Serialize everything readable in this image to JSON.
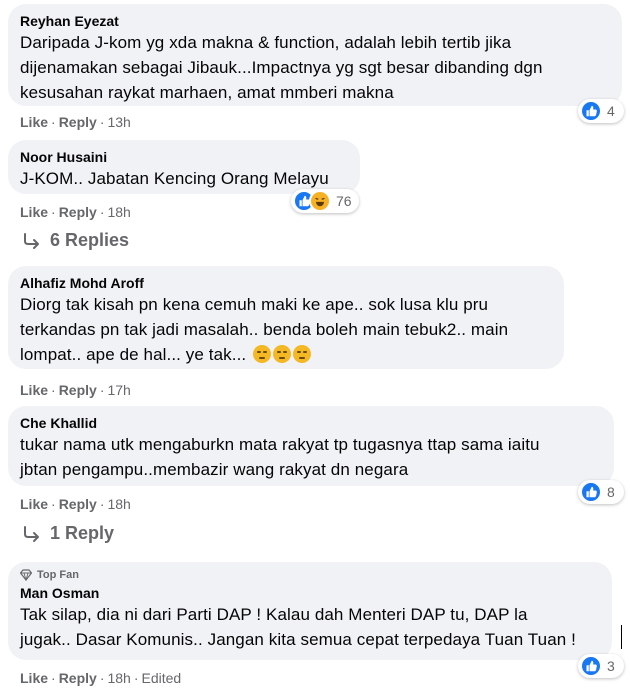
{
  "comments": [
    {
      "author": "Reyhan Eyezat",
      "text": "Daripada J-kom yg xda makna & function, adalah lebih tertib jika\ndijenamakan sebagai Jibauk...Impactnya yg sgt besar dibanding dgn\nkesusahan raykat marhaen, amat mmberi makna",
      "like": "Like",
      "reply": "Reply",
      "time": "13h",
      "reaction_count": "4"
    },
    {
      "author": "Noor Husaini",
      "text": "J-KOM.. Jabatan Kencing Orang Melayu",
      "like": "Like",
      "reply": "Reply",
      "time": "18h",
      "reaction_count": "76",
      "replies_label": "6 Replies"
    },
    {
      "author": "Alhafiz Mohd Aroff",
      "text": "Diorg tak kisah pn kena cemuh maki ke ape.. sok lusa klu pru\nterkandas pn tak jadi masalah.. benda boleh main tebuk2.. main\nlompat.. ape de hal... ye tak...",
      "like": "Like",
      "reply": "Reply",
      "time": "17h"
    },
    {
      "author": "Che Khallid",
      "text": "tukar nama utk mengaburkn mata rakyat tp tugasnya ttap sama iaitu\njbtan pengampu..membazir wang rakyat dn negara",
      "like": "Like",
      "reply": "Reply",
      "time": "18h",
      "reaction_count": "8",
      "replies_label": "1 Reply"
    },
    {
      "badge": "Top Fan",
      "author": "Man Osman",
      "text": "Tak silap, dia ni dari Parti DAP ! Kalau dah Menteri DAP tu, DAP la\njugak.. Dasar Komunis.. Jangan kita semua cepat terpedaya Tuan Tuan !",
      "like": "Like",
      "reply": "Reply",
      "time": "18h",
      "edited": "Edited",
      "reaction_count": "3"
    }
  ],
  "colors": {
    "bubble": "#f0f2f5",
    "meta": "#65676b",
    "like_blue": "#1877f2",
    "haha_yellow": "#f7b125"
  },
  "icons": [
    "like-reaction-icon",
    "haha-reaction-icon",
    "reply-arrow-icon",
    "top-fan-gem-icon",
    "unamused-emoji-icon"
  ]
}
